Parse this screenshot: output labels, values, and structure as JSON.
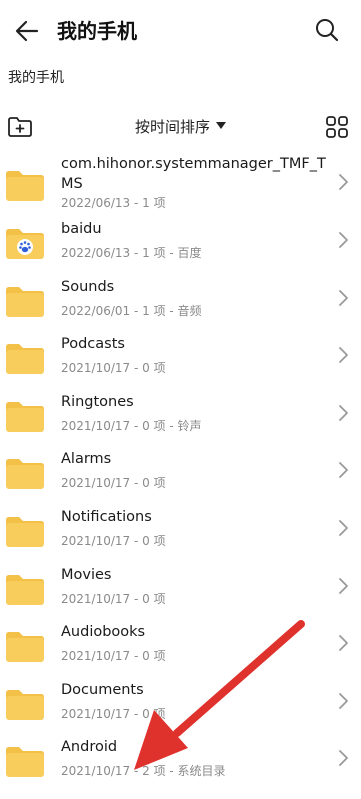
{
  "header": {
    "title": "我的手机"
  },
  "breadcrumb": "我的手机",
  "toolbar": {
    "sort_label": "按时间排序"
  },
  "colors": {
    "folder": "#F8CD5C",
    "folder_tab": "#F3C048",
    "annotation_arrow": "#E0322D"
  },
  "files": [
    {
      "name": "com.hihonor.systemmanager_TMF_TMS",
      "meta": "2022/06/13 - 1 项"
    },
    {
      "name": "baidu",
      "meta": "2022/06/13 - 1 项 - 百度",
      "icon": "baidu-paw-icon"
    },
    {
      "name": "Sounds",
      "meta": "2022/06/01 - 1 项 - 音频"
    },
    {
      "name": "Podcasts",
      "meta": "2021/10/17 - 0 项"
    },
    {
      "name": "Ringtones",
      "meta": "2021/10/17 - 0 项 - 铃声"
    },
    {
      "name": "Alarms",
      "meta": "2021/10/17 - 0 项"
    },
    {
      "name": "Notifications",
      "meta": "2021/10/17 - 0 项"
    },
    {
      "name": "Movies",
      "meta": "2021/10/17 - 0 项"
    },
    {
      "name": "Audiobooks",
      "meta": "2021/10/17 - 0 项"
    },
    {
      "name": "Documents",
      "meta": "2021/10/17 - 0 项"
    },
    {
      "name": "Android",
      "meta": "2021/10/17 - 2 项 - 系统目录"
    }
  ]
}
